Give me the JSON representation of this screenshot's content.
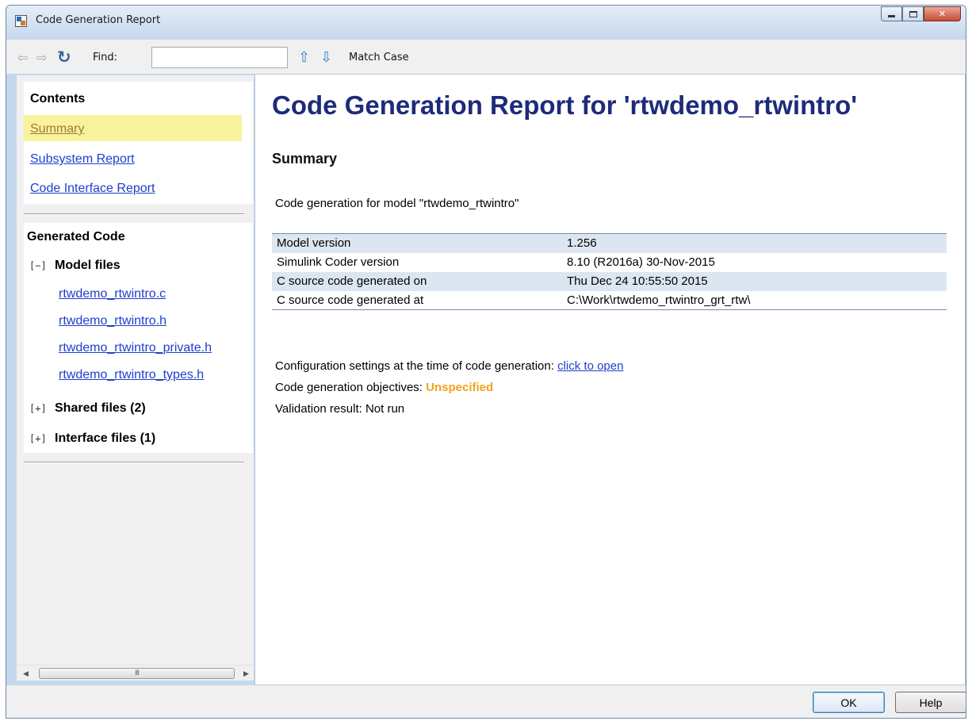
{
  "window": {
    "title": "Code Generation Report",
    "controls": {
      "minimize": "minimize-icon",
      "maximize": "maximize-icon",
      "close": "close-icon"
    }
  },
  "toolbar": {
    "back_icon": "back-arrow-icon",
    "forward_icon": "forward-arrow-icon",
    "refresh_icon": "refresh-icon",
    "find_label": "Find:",
    "find_value": "",
    "find_up_icon": "arrow-up-icon",
    "find_down_icon": "arrow-down-icon",
    "match_case_label": "Match Case"
  },
  "sidebar": {
    "contents_title": "Contents",
    "contents_links": [
      "Summary",
      "Subsystem Report",
      "Code Interface Report"
    ],
    "active_link": "Summary",
    "generated_code_title": "Generated Code",
    "model_files": {
      "toggle": "[−]",
      "label": "Model files",
      "files": [
        "rtwdemo_rtwintro.c",
        "rtwdemo_rtwintro.h",
        "rtwdemo_rtwintro_private.h",
        "rtwdemo_rtwintro_types.h"
      ]
    },
    "shared_files": {
      "toggle": "[+]",
      "label": "Shared files (2)"
    },
    "interface_files": {
      "toggle": "[+]",
      "label": "Interface files (1)"
    },
    "scrollbar_grip": "III"
  },
  "main": {
    "title": "Code Generation Report for 'rtwdemo_rtwintro'",
    "section_title": "Summary",
    "generation_text": "Code generation for model \"rtwdemo_rtwintro\"",
    "table": [
      {
        "key": "Model version",
        "value": "1.256"
      },
      {
        "key": "Simulink Coder version",
        "value": "8.10 (R2016a) 30-Nov-2015"
      },
      {
        "key": "C source code generated on",
        "value": "Thu Dec 24 10:55:50 2015"
      },
      {
        "key": "C source code generated at",
        "value": "C:\\Work\\rtwdemo_rtwintro_grt_rtw\\"
      }
    ],
    "config_text": "Configuration settings at the time of code generation:",
    "config_link": "click to open",
    "objectives_text": "Code generation objectives:",
    "objectives_value": "Unspecified",
    "validation_text": "Validation result: Not run"
  },
  "footer": {
    "ok_label": "OK",
    "help_label": "Help"
  },
  "colors": {
    "link": "#1d3fcc",
    "title": "#1e2b7a",
    "highlight": "#f8f29c",
    "unspecified": "#f2a21e",
    "table_stripe": "#dce6f1"
  }
}
